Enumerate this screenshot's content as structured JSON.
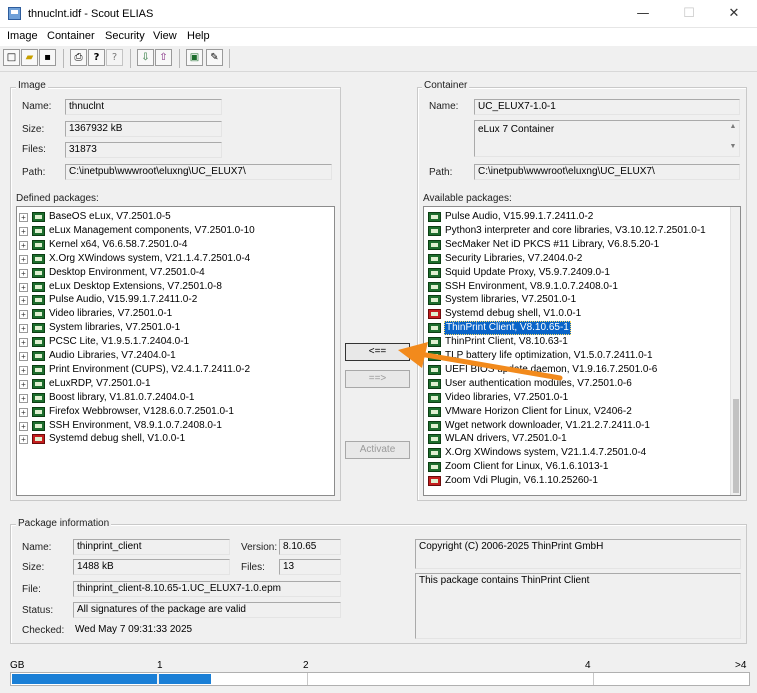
{
  "window": {
    "title": "thnuclnt.idf - Scout ELIAS",
    "min_glyph": "—",
    "max_glyph": "☐",
    "close_glyph": "✕"
  },
  "menu": [
    "Image",
    "Container",
    "Security",
    "View",
    "Help"
  ],
  "toolbar": [
    {
      "icon": "new-file-icon",
      "glyph": "□"
    },
    {
      "icon": "open-folder-icon",
      "glyph": "▰"
    },
    {
      "icon": "save-icon",
      "glyph": "▪"
    },
    {
      "icon": "print-icon",
      "glyph": "⎙"
    },
    {
      "icon": "help-icon",
      "glyph": "?"
    },
    {
      "icon": "context-help-icon",
      "glyph": "?"
    },
    {
      "icon": "import-icon",
      "glyph": "⇩"
    },
    {
      "icon": "export-icon",
      "glyph": "⇧"
    },
    {
      "icon": "package-icon",
      "glyph": "▣"
    },
    {
      "icon": "verify-icon",
      "glyph": "✎"
    }
  ],
  "image": {
    "group_label": "Image",
    "name_label": "Name:",
    "name": "thnuclnt",
    "size_label": "Size:",
    "size": "1367932 kB",
    "files_label": "Files:",
    "files": "31873",
    "path_label": "Path:",
    "path": "C:\\inetpub\\wwwroot\\eluxng\\UC_ELUX7\\",
    "defined_label": "Defined packages:",
    "packages": [
      {
        "text": "BaseOS eLux, V7.2501.0-5",
        "red": false
      },
      {
        "text": "eLux Management components, V7.2501.0-10",
        "red": false
      },
      {
        "text": "Kernel x64, V6.6.58.7.2501.0-4",
        "red": false
      },
      {
        "text": "X.Org XWindows system, V21.1.4.7.2501.0-4",
        "red": false
      },
      {
        "text": "Desktop Environment, V7.2501.0-4",
        "red": false
      },
      {
        "text": "eLux Desktop Extensions, V7.2501.0-8",
        "red": false
      },
      {
        "text": "Pulse Audio, V15.99.1.7.2411.0-2",
        "red": false
      },
      {
        "text": "Video libraries, V7.2501.0-1",
        "red": false
      },
      {
        "text": "System libraries, V7.2501.0-1",
        "red": false
      },
      {
        "text": "PCSC Lite, V1.9.5.1.7.2404.0-1",
        "red": false
      },
      {
        "text": "Audio Libraries, V7.2404.0-1",
        "red": false
      },
      {
        "text": "Print Environment (CUPS), V2.4.1.7.2411.0-2",
        "red": false
      },
      {
        "text": "eLuxRDP, V7.2501.0-1",
        "red": false
      },
      {
        "text": "Boost library, V1.81.0.7.2404.0-1",
        "red": false
      },
      {
        "text": "Firefox Webbrowser, V128.6.0.7.2501.0-1",
        "red": false
      },
      {
        "text": "SSH Environment, V8.9.1.0.7.2408.0-1",
        "red": false
      },
      {
        "text": "Systemd debug shell, V1.0.0-1",
        "red": true
      }
    ]
  },
  "container": {
    "group_label": "Container",
    "name_label": "Name:",
    "name": "UC_ELUX7-1.0-1",
    "description": "eLux 7 Container",
    "path_label": "Path:",
    "path": "C:\\inetpub\\wwwroot\\eluxng\\UC_ELUX7\\",
    "available_label": "Available packages:",
    "packages": [
      {
        "text": "Pulse Audio, V15.99.1.7.2411.0-2",
        "red": false
      },
      {
        "text": "Python3 interpreter and core libraries, V3.10.12.7.2501.0-1",
        "red": false
      },
      {
        "text": "SecMaker Net iD PKCS #11 Library, V6.8.5.20-1",
        "red": false
      },
      {
        "text": "Security Libraries, V7.2404.0-2",
        "red": false
      },
      {
        "text": "Squid Update Proxy, V5.9.7.2409.0-1",
        "red": false
      },
      {
        "text": "SSH Environment, V8.9.1.0.7.2408.0-1",
        "red": false
      },
      {
        "text": "System libraries, V7.2501.0-1",
        "red": false
      },
      {
        "text": "Systemd debug shell, V1.0.0-1",
        "red": true
      },
      {
        "text": "ThinPrint Client, V8.10.65-1",
        "red": false,
        "selected": true
      },
      {
        "text": "ThinPrint Client, V8.10.63-1",
        "red": false
      },
      {
        "text": "TLP battery life optimization, V1.5.0.7.2411.0-1",
        "red": false
      },
      {
        "text": "UEFI BIOS update daemon, V1.9.16.7.2501.0-6",
        "red": false
      },
      {
        "text": "User authentication modules, V7.2501.0-6",
        "red": false
      },
      {
        "text": "Video libraries, V7.2501.0-1",
        "red": false
      },
      {
        "text": "VMware Horizon Client for Linux, V2406-2",
        "red": false
      },
      {
        "text": "Wget network downloader, V1.21.2.7.2411.0-1",
        "red": false
      },
      {
        "text": "WLAN drivers, V7.2501.0-1",
        "red": false
      },
      {
        "text": "X.Org XWindows system, V21.1.4.7.2501.0-4",
        "red": false
      },
      {
        "text": "Zoom Client for Linux, V6.1.6.1013-1",
        "red": false
      },
      {
        "text": "Zoom Vdi Plugin, V6.1.10.25260-1",
        "red": true
      }
    ]
  },
  "buttons": {
    "add": "<==",
    "remove": "==>",
    "activate": "Activate"
  },
  "package_info": {
    "group_label": "Package information",
    "name_label": "Name:",
    "name": "thinprint_client",
    "version_label": "Version:",
    "version": "8.10.65",
    "size_label": "Size:",
    "size": "1488 kB",
    "files_label": "Files:",
    "files": "13",
    "file_label": "File:",
    "file": "thinprint_client-8.10.65-1.UC_ELUX7-1.0.epm",
    "status_label": "Status:",
    "status": "All signatures of the package are valid",
    "checked_label": "Checked:",
    "checked": "Wed May  7 09:31:33 2025",
    "copyright": "Copyright (C) 2006-2025 ThinPrint GmbH",
    "description": "This package contains ThinPrint Client"
  },
  "usage_bar": {
    "unit": "GB",
    "ticks": [
      "1",
      "2",
      "4",
      ">4"
    ],
    "used_fraction": 0.27,
    "colors": {
      "used": "#1a7fd6",
      "background": "#ffffff"
    }
  },
  "colors": {
    "annotation_arrow": "#f28a1c",
    "selection": "#0a64c8"
  }
}
